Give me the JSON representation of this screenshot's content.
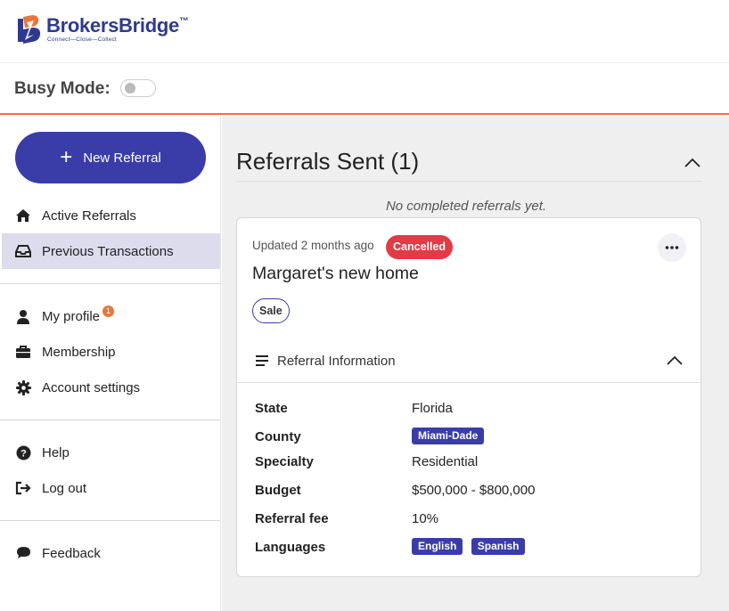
{
  "brand": {
    "name": "BrokersBridge",
    "trademark": "™",
    "tagline": "Connect—Close—Collect",
    "colors": {
      "primary": "#3a3da8",
      "accent": "#e8763a",
      "danger": "#e13b45"
    }
  },
  "busy_mode": {
    "label": "Busy Mode:",
    "enabled": false
  },
  "sidebar": {
    "new_referral_label": "New Referral",
    "items": [
      {
        "label": "Active Referrals",
        "icon": "home-icon"
      },
      {
        "label": "Previous Transactions",
        "icon": "inbox-icon",
        "active": true
      },
      {
        "label": "My profile",
        "icon": "user-icon",
        "badge": "1"
      },
      {
        "label": "Membership",
        "icon": "briefcase-icon"
      },
      {
        "label": "Account settings",
        "icon": "gear-icon"
      },
      {
        "label": "Help",
        "icon": "help-circle-icon"
      },
      {
        "label": "Log out",
        "icon": "logout-icon"
      },
      {
        "label": "Feedback",
        "icon": "chat-bubble-icon"
      }
    ]
  },
  "main": {
    "title": "Referrals Sent (1)",
    "empty_note": "No completed referrals yet.",
    "card": {
      "updated": "Updated 2 months ago",
      "status": "Cancelled",
      "title": "Margaret's new home",
      "type": "Sale",
      "section_title": "Referral Information",
      "fields": {
        "state": {
          "label": "State",
          "value": "Florida"
        },
        "county": {
          "label": "County",
          "tags": [
            "Miami-Dade"
          ]
        },
        "specialty": {
          "label": "Specialty",
          "value": "Residential"
        },
        "budget": {
          "label": "Budget",
          "value": "$500,000 - $800,000"
        },
        "referral_fee": {
          "label": "Referral fee",
          "value": "10%"
        },
        "languages": {
          "label": "Languages",
          "tags": [
            "English",
            "Spanish"
          ]
        }
      }
    }
  }
}
